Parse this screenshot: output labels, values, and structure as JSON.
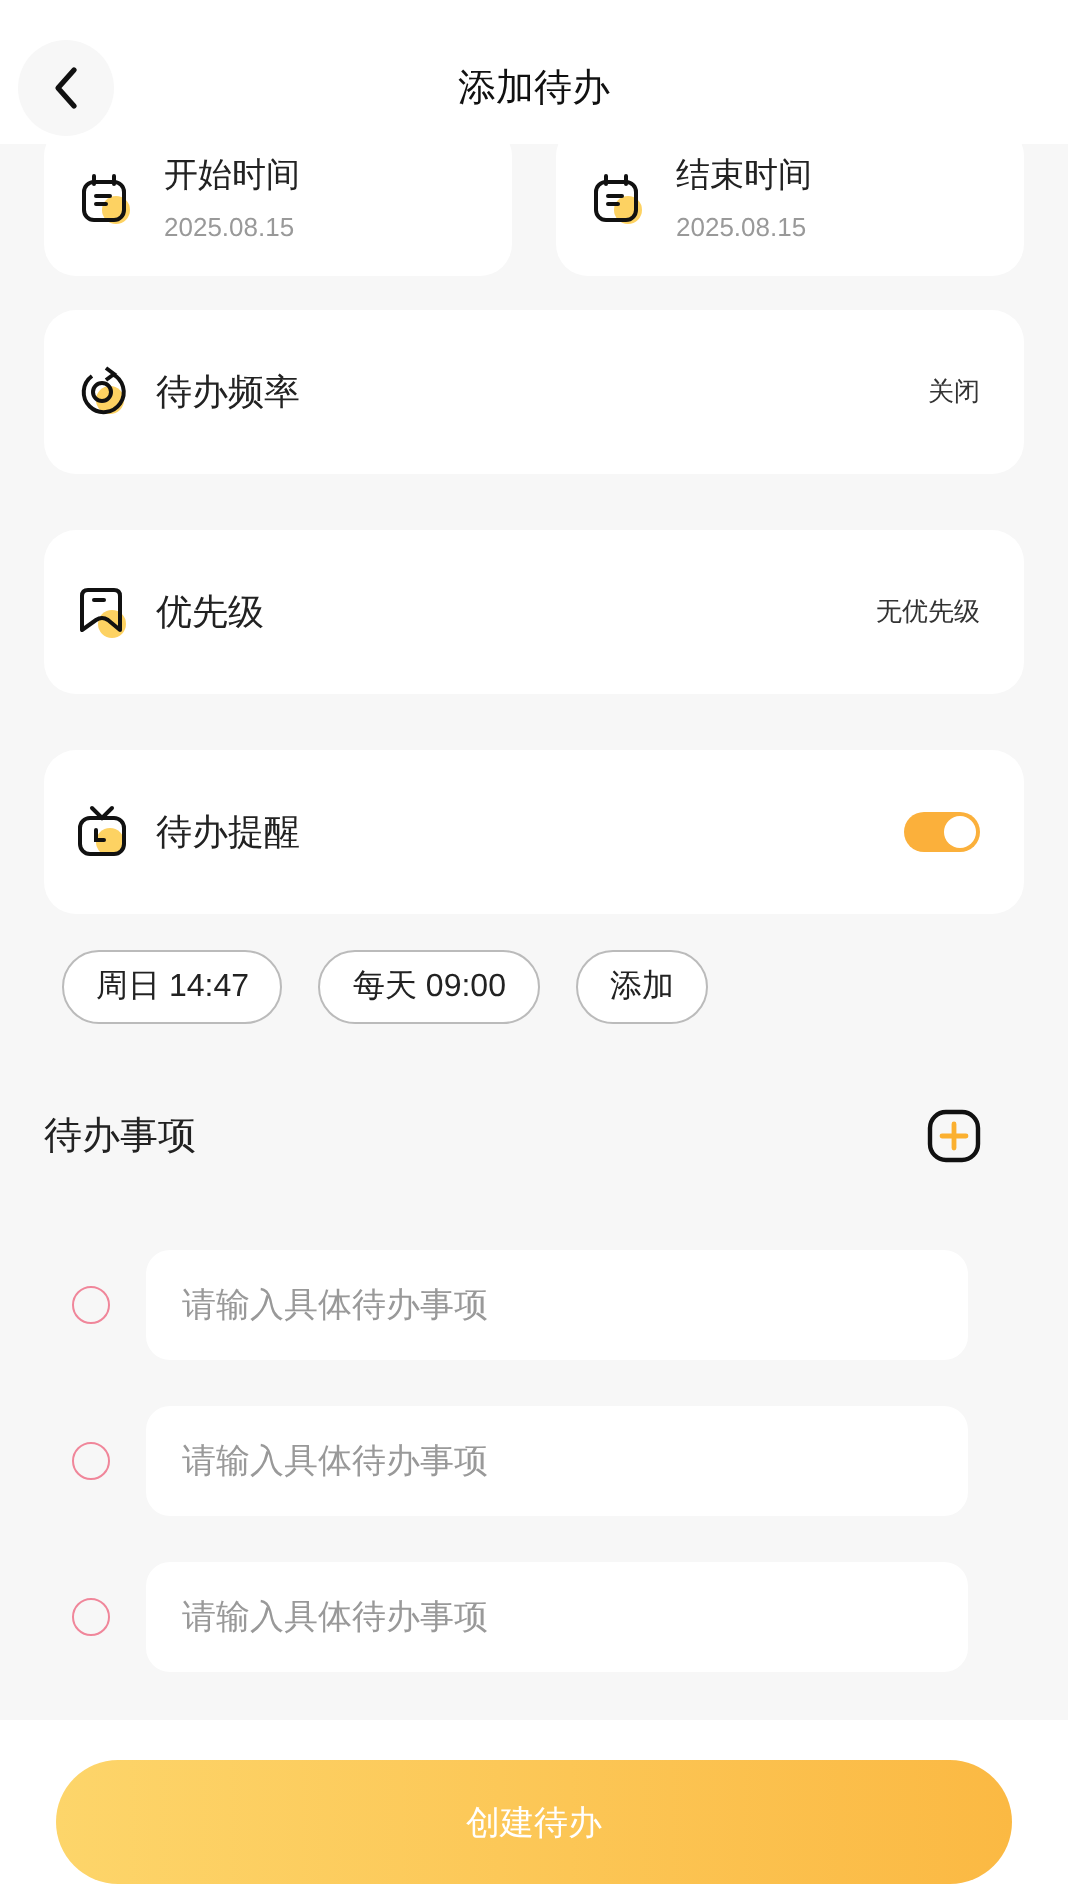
{
  "header": {
    "title": "添加待办"
  },
  "date_cards": [
    {
      "title": "开始时间",
      "date": "2025.08.15"
    },
    {
      "title": "结束时间",
      "date": "2025.08.15"
    }
  ],
  "settings": [
    {
      "kind": "value",
      "label": "待办频率",
      "value": "关闭"
    },
    {
      "kind": "value",
      "label": "优先级",
      "value": "无优先级"
    },
    {
      "kind": "toggle",
      "label": "待办提醒",
      "on": true
    }
  ],
  "reminder_chips": [
    "周日 14:47",
    "每天 09:00",
    "添加"
  ],
  "todo_section": {
    "title": "待办事项",
    "items": [
      {
        "placeholder": "请输入具体待办事项",
        "checked": false
      },
      {
        "placeholder": "请输入具体待办事项",
        "checked": false
      },
      {
        "placeholder": "请输入具体待办事项",
        "checked": false
      }
    ]
  },
  "create_button": {
    "label": "创建待办"
  }
}
